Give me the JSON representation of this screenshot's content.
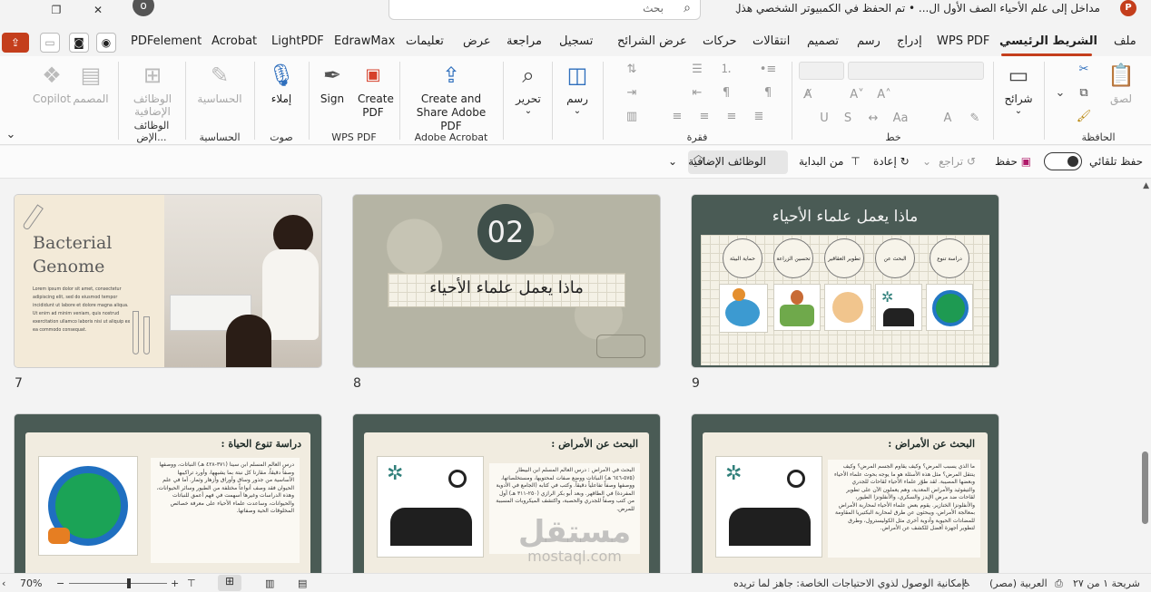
{
  "titlebar": {
    "doc_title": "مداخل إلى علم الأحياء الصف الأول ال... • تم الحفظ في الكمبيوتر الشخصي هذا",
    "search_placeholder": "بحث",
    "app_logo": "P"
  },
  "tabs": [
    {
      "label": "ملف",
      "active": false
    },
    {
      "label": "الشريط الرئيسي",
      "active": true
    },
    {
      "label": "WPS PDF",
      "active": false
    },
    {
      "label": "إدراج",
      "active": false
    },
    {
      "label": "رسم",
      "active": false
    },
    {
      "label": "تصميم",
      "active": false
    },
    {
      "label": "انتقالات",
      "active": false
    },
    {
      "label": "حركات",
      "active": false
    },
    {
      "label": "عرض الشرائح",
      "active": false
    },
    {
      "label": "تسجيل",
      "active": false
    },
    {
      "label": "مراجعة",
      "active": false
    },
    {
      "label": "عرض",
      "active": false
    },
    {
      "label": "تعليمات",
      "active": false
    },
    {
      "label": "EdrawMax",
      "active": false
    },
    {
      "label": "LightPDF",
      "active": false
    },
    {
      "label": "Acrobat",
      "active": false
    },
    {
      "label": "PDFelement",
      "active": false
    }
  ],
  "ribbon": {
    "clipboard": {
      "label": "الحافظة",
      "paste": "لصق"
    },
    "slides": {
      "new_slide": "شرائح"
    },
    "font": {
      "label": "خط"
    },
    "paragraph": {
      "label": "فقرة"
    },
    "drawing": {
      "draw": "رسم",
      "edit": "تحرير"
    },
    "acrobat": {
      "label": "Adobe Acrobat",
      "create_share": "Create and Share Adobe PDF"
    },
    "wps": {
      "label": "WPS PDF",
      "sign": "Sign",
      "create_pdf": "Create PDF"
    },
    "voice": {
      "label": "صوت",
      "dictate": "إملاء"
    },
    "sensitivity": {
      "label": "الحساسية",
      "btn": "الحساسية"
    },
    "addins": {
      "label": "الوظائف الإض...",
      "btn": "الوظائف الإضافية"
    },
    "designer": {
      "btn": "المصمم"
    },
    "copilot": {
      "btn": "Copilot"
    }
  },
  "quickrow": {
    "autosave": "حفظ تلقائي",
    "save": "حفظ",
    "undo": "تراجع",
    "redo": "إعادة",
    "from_start": "من البداية",
    "addins": "الوظائف الإضافية"
  },
  "slides": {
    "s7": {
      "num": "7",
      "title_line1": "Bacterial",
      "title_line2": "Genome",
      "body": "Lorem ipsum dolor sit amet, consectetur adipiscing elit, sed do eiusmod tempor incididunt ut labore et dolore magna aliqua. Ut enim ad minim veniam, quis nostrud exercitation ullamco laboris nisi ut aliquip ex ea commodo consequat."
    },
    "s8": {
      "num": "8",
      "number": "02",
      "title": "ماذا يعمل علماء الأحياء"
    },
    "s9": {
      "num": "9",
      "title": "ماذا يعمل علماء الأحياء",
      "circles": [
        "دراسة تنوع الحياة",
        "البحث عن الأمراض",
        "تطوير العقاقير",
        "تحسين الزراعة",
        "حماية البيئة"
      ]
    },
    "s10": {
      "title": "دراسة تنوع الحياة :",
      "body": "درس العالم المسلم ابن سينا (٣٧١-٤٢٨ هـ) النباتات، ووصفها وصفاً دقيقاً، مقارنا كل نبتة بما يشبهها، وأورد تراكيبها الأساسية من جذور وساق وأوراق وأزهار وثمار. أما في علم الحيوان فقد وصف أنواعاً مختلفة من الطيور وسائر الحيوانات، وهذه الدراسات وغيرها أسهمت في فهم أعمق للنباتات والحيوانات، وساعدت علماء الأحياء على معرفة خصائص المخلوقات الحية وصفاتها."
    },
    "s11": {
      "title": "البحث عن الأمراض :",
      "body": "البحث في الأمراض : درس العالم المسلم ابن البيطار (٥٧٥-٦٤٦ هـ) النباتات ووضع صفات لمحتويها، ومستخلصاتها، ووصفها وصفاً تفاعلياً دقيقاً. وكتب في كتابه (الجامع في الأدوية المفردة) في الطاقهر. وبعد أبو بكر الرازي (٢٥٠-٣١١ هـ) أول من كتب وصفاً للجدري والحصبة، واكتشف الميكروبات المسببة للمرض."
    },
    "s12": {
      "title": "البحث عن الأمراض :",
      "body": "ما الذي يسبب المرض؟ وكيف يقاوم الجسم المرض؟ وكيف ينتقل المرض؟ مثل هذه الأسئلة هو ما يوجه بحوث علماء الأحياء وبعضها المصيبة. لقد طوّر علماء الأحياء لقاحات للجدري والتيفوئيد والأمراض المعدية، وهم يعملون الآن على تطوير لقاحات ضد مرض الإيدز والسكري، والأنفلونزا الطيور، والأنفلونزا الخنازير. يقوم بعض علماء الأحياء لمحاربة الأمراض بمعالجة الأمراض، ويبحثون عن طرق لمحاربة البكتيريا المقاومة للمضادات الحيوية وأدوية أخرى مثل الكوليسترول، وطرق لتطوير أجهزة أفضل للكشف عن الأمراض."
    }
  },
  "watermark": {
    "line1": "مستقل",
    "line2": "mostaql.com"
  },
  "statusbar": {
    "slide_info": "شريحة ١ من ٢٧",
    "language": "العربية (مصر)",
    "accessibility": "إمكانية الوصول لذوي الاحتياجات الخاصة: جاهز لما تريده",
    "zoom": "70%"
  },
  "colors": {
    "accent": "#c43e1c",
    "slide_frame": "#4a5b55",
    "paper": "#f1ece0"
  }
}
